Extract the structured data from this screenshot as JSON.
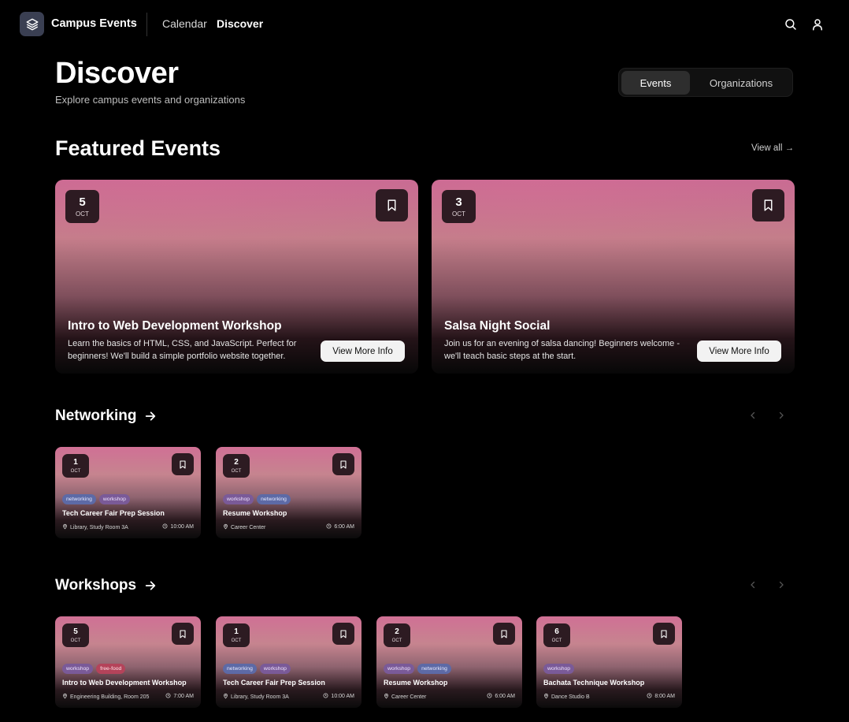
{
  "nav": {
    "brand": "Campus Events",
    "links": [
      {
        "label": "Calendar"
      },
      {
        "label": "Discover"
      }
    ],
    "icons": [
      "search-icon",
      "user-icon"
    ]
  },
  "header": {
    "title": "Discover",
    "subtitle": "Explore campus events and organizations",
    "toggle": [
      "Events",
      "Organizations"
    ],
    "toggle_selected": "Events"
  },
  "featured": {
    "title": "Featured Events",
    "view_all": "View all →",
    "events": [
      {
        "day": "5",
        "month": "OCT",
        "title": "Intro to Web Development Workshop",
        "description": "Learn the basics of HTML, CSS, and JavaScript. Perfect for beginners! We'll build a simple portfolio website together.",
        "button": "View More Info"
      },
      {
        "day": "3",
        "month": "OCT",
        "title": "Salsa Night Social",
        "description": "Join us for an evening of salsa dancing! Beginners welcome - we'll teach basic steps at the start.",
        "button": "View More Info"
      }
    ]
  },
  "rows": [
    {
      "title": "Networking",
      "cards": [
        {
          "day": "1",
          "month": "OCT",
          "tags": [
            "networking",
            "workshop"
          ],
          "title": "Tech Career Fair Prep Session",
          "location": "Library, Study Room 3A",
          "time": "10:00 AM"
        },
        {
          "day": "2",
          "month": "OCT",
          "tags": [
            "workshop",
            "networking"
          ],
          "title": "Resume Workshop",
          "location": "Career Center",
          "time": "6:00 AM"
        }
      ]
    },
    {
      "title": "Workshops",
      "cards": [
        {
          "day": "5",
          "month": "OCT",
          "tags": [
            "workshop",
            "free-food"
          ],
          "title": "Intro to Web Development Workshop",
          "location": "Engineering Building, Room 205",
          "time": "7:00 AM"
        },
        {
          "day": "1",
          "month": "OCT",
          "tags": [
            "networking",
            "workshop"
          ],
          "title": "Tech Career Fair Prep Session",
          "location": "Library, Study Room 3A",
          "time": "10:00 AM"
        },
        {
          "day": "2",
          "month": "OCT",
          "tags": [
            "workshop",
            "networking"
          ],
          "title": "Resume Workshop",
          "location": "Career Center",
          "time": "6:00 AM"
        },
        {
          "day": "6",
          "month": "OCT",
          "tags": [
            "workshop"
          ],
          "title": "Bachata Technique Workshop",
          "location": "Dance Studio B",
          "time": "8:00 AM"
        }
      ]
    }
  ],
  "colors": {
    "background": "#000000",
    "card_pink": "#c96b93",
    "badge": "#2d1b22",
    "tag_networking": "#5d6aa6",
    "tag_workshop": "#7a5a98",
    "tag_free_food": "#b4435a"
  }
}
